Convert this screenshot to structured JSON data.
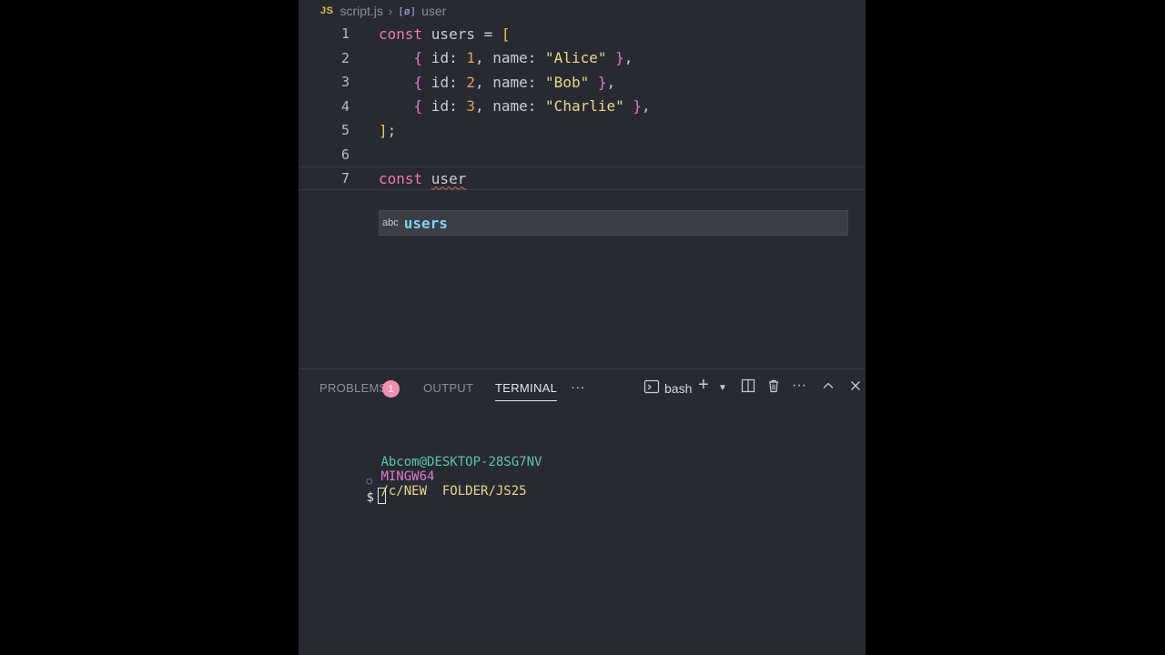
{
  "breadcrumb": {
    "file_badge": "JS",
    "file": "script.js",
    "symbol_icon": "[ø]",
    "symbol": "user"
  },
  "editor": {
    "lines": [
      {
        "n": "1",
        "tokens": [
          [
            "kw",
            "const "
          ],
          [
            "id",
            "users"
          ],
          [
            "id",
            " = "
          ],
          [
            "br1",
            "["
          ]
        ]
      },
      {
        "n": "2",
        "tokens": [
          [
            "id",
            "    "
          ],
          [
            "br2",
            "{"
          ],
          [
            "prop",
            " id: "
          ],
          [
            "num",
            "1"
          ],
          [
            "id",
            ", name: "
          ],
          [
            "str",
            "\"Alice\""
          ],
          [
            "id",
            " "
          ],
          [
            "br2",
            "}"
          ],
          [
            "id",
            ","
          ]
        ]
      },
      {
        "n": "3",
        "tokens": [
          [
            "id",
            "    "
          ],
          [
            "br2",
            "{"
          ],
          [
            "prop",
            " id: "
          ],
          [
            "num",
            "2"
          ],
          [
            "id",
            ", name: "
          ],
          [
            "str",
            "\"Bob\""
          ],
          [
            "id",
            " "
          ],
          [
            "br2",
            "}"
          ],
          [
            "id",
            ","
          ]
        ]
      },
      {
        "n": "4",
        "tokens": [
          [
            "id",
            "    "
          ],
          [
            "br2",
            "{"
          ],
          [
            "prop",
            " id: "
          ],
          [
            "num",
            "3"
          ],
          [
            "id",
            ", name: "
          ],
          [
            "str",
            "\"Charlie\""
          ],
          [
            "id",
            " "
          ],
          [
            "br2",
            "}"
          ],
          [
            "id",
            ","
          ]
        ]
      },
      {
        "n": "5",
        "tokens": [
          [
            "br1",
            "]"
          ],
          [
            "id",
            ";"
          ]
        ]
      },
      {
        "n": "6",
        "tokens": []
      },
      {
        "n": "7",
        "tokens": [
          [
            "kw",
            "const "
          ],
          [
            "squig",
            "user"
          ]
        ]
      }
    ],
    "suggestion": {
      "kind": "abc",
      "label": "users"
    }
  },
  "panel": {
    "tabs": {
      "problems": "PROBLEMS",
      "problems_count": "1",
      "output": "OUTPUT",
      "terminal": "TERMINAL",
      "more": "···"
    },
    "shell": "bash"
  },
  "terminal": {
    "user": "Abcom@DESKTOP-28SG7NV",
    "env": "MINGW64",
    "path": "/c/NEW  FOLDER/JS25",
    "prompt": "$"
  },
  "colors": {
    "editor_bg": "#272a31",
    "keyword": "#ef7aa8",
    "number": "#e2a05a",
    "string": "#e8d88a",
    "suggest": "#7fd4f0"
  }
}
